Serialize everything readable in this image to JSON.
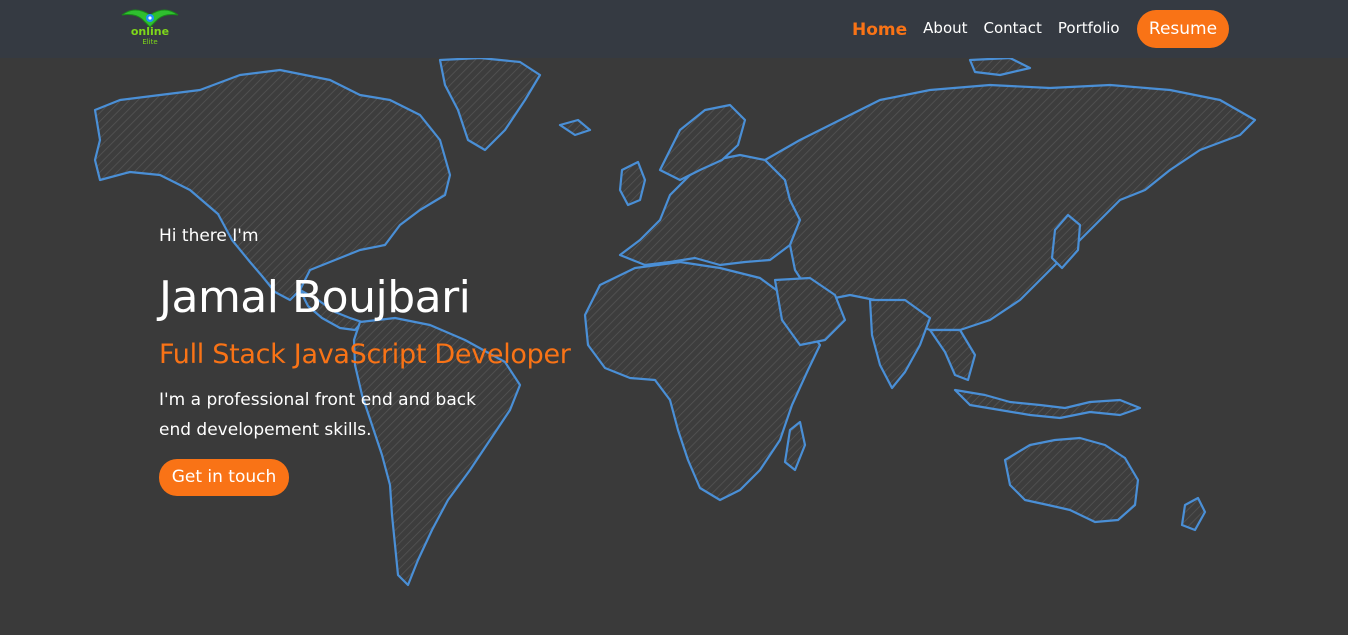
{
  "brand": {
    "logo_text": "online",
    "logo_subtext": "Elite"
  },
  "nav": {
    "items": [
      {
        "label": "Home",
        "active": true
      },
      {
        "label": "About",
        "active": false
      },
      {
        "label": "Contact",
        "active": false
      },
      {
        "label": "Portfolio",
        "active": false
      }
    ],
    "resume_label": "Resume"
  },
  "hero": {
    "greeting": "Hi there I'm",
    "name": "Jamal Boujbari",
    "role": "Full Stack JavaScript Developer",
    "description": "I'm a professional front end and back end developement skills.",
    "cta_label": "Get in touch"
  },
  "colors": {
    "accent": "#f97316",
    "navbar_bg": "#353a42",
    "page_bg": "#3a3a3a",
    "map_outline": "#4a8fd6",
    "logo_green": "#7fd81a"
  },
  "icons": {
    "logo": "eagle-logo-icon",
    "background": "world-map-icon"
  }
}
